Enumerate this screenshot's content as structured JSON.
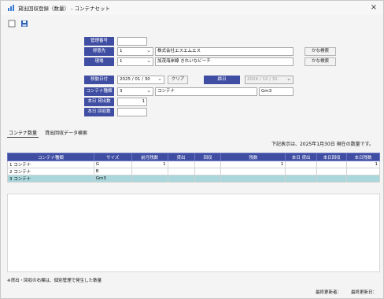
{
  "window": {
    "title": "貸出回収登録（数量） - コンテナセット",
    "close_symbol": "×"
  },
  "toolbar": {
    "new_icon": "new-document-icon",
    "save_icon": "save-icon"
  },
  "form": {
    "kanri_no": {
      "label": "管理番号",
      "value": ""
    },
    "torihikisaki": {
      "label": "得意先",
      "code": "1",
      "name": "株式会社エスエムエス",
      "search": "かな検索"
    },
    "genba": {
      "label": "現場",
      "code": "1",
      "name": "加茂海岸線 きれいなビーチ",
      "search": "かな検索"
    },
    "ido_date": {
      "label": "移動日付",
      "value": "2025 / 01 / 30",
      "clear": "クリア"
    },
    "hizuke": {
      "label": "締日",
      "value": "2024 / 12 / 31"
    },
    "container": {
      "label": "コンテナ種類",
      "code": "3",
      "name": "コンテナ",
      "size": "Gm3"
    },
    "today_kashidashi": {
      "label": "本日 貸出数",
      "value": "1"
    },
    "today_kaishu": {
      "label": "本日 回収数",
      "value": ""
    }
  },
  "tabs": [
    {
      "label": "コンテナ数量",
      "active": true
    },
    {
      "label": "貸出回収データ検索",
      "active": false
    }
  ],
  "grid": {
    "note": "下記表示は、2025年1月30日 現在の数量です。",
    "headers": [
      "コンテナ種類",
      "サイズ",
      "前月残数",
      "貸出",
      "回収",
      "残数",
      "本日 貸出",
      "本日回収",
      "本日残数"
    ],
    "rows": [
      {
        "idx": "1",
        "type": "コンテナ",
        "size": "G",
        "prev": "1",
        "lend": "",
        "ret": "",
        "remain": "1",
        "tlend": "",
        "tret": "",
        "tremain": "1",
        "selected": false
      },
      {
        "idx": "2",
        "type": "コンテナ",
        "size": "B",
        "prev": "",
        "lend": "",
        "ret": "",
        "remain": "",
        "tlend": "",
        "tret": "",
        "tremain": "",
        "selected": false
      },
      {
        "idx": "3",
        "type": "コンテナ",
        "size": "Gm3",
        "prev": "",
        "lend": "",
        "ret": "",
        "remain": "",
        "tlend": "",
        "tret": "",
        "tremain": "",
        "selected": true
      }
    ]
  },
  "footnote": "※貸出・回収の右欄は、個別管理で発生した数量",
  "status": {
    "last_updated_by": "最終更新者：",
    "last_updated_date": "最終更新日："
  }
}
